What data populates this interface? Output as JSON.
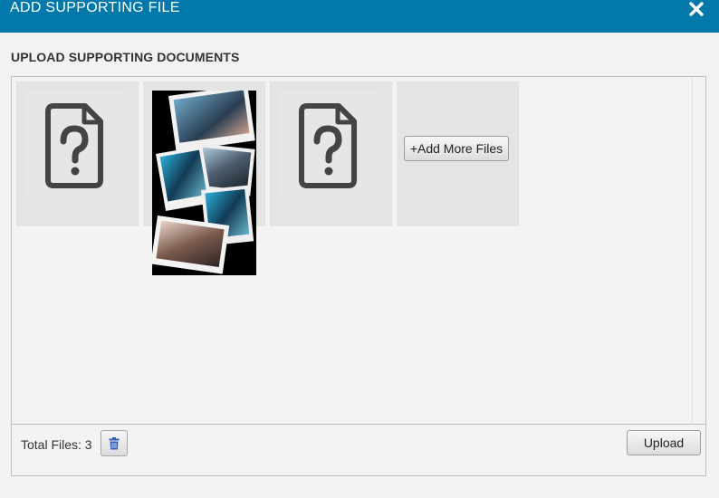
{
  "dialog": {
    "title": "ADD SUPPORTING FILE",
    "close_icon": "close-icon"
  },
  "section": {
    "title": "UPLOAD SUPPORTING DOCUMENTS"
  },
  "files": [
    {
      "kind": "unknown",
      "icon": "unknown-file-icon"
    },
    {
      "kind": "image",
      "icon": "photo-collage-thumbnail"
    },
    {
      "kind": "unknown",
      "icon": "unknown-file-icon"
    }
  ],
  "add_more": {
    "label": "+Add More Files"
  },
  "footer": {
    "total_label": "Total Files: 3",
    "trash_icon": "trash-icon",
    "upload_label": "Upload"
  },
  "colors": {
    "titlebar": "#0278ab",
    "trash_icon": "#2f5db8"
  }
}
